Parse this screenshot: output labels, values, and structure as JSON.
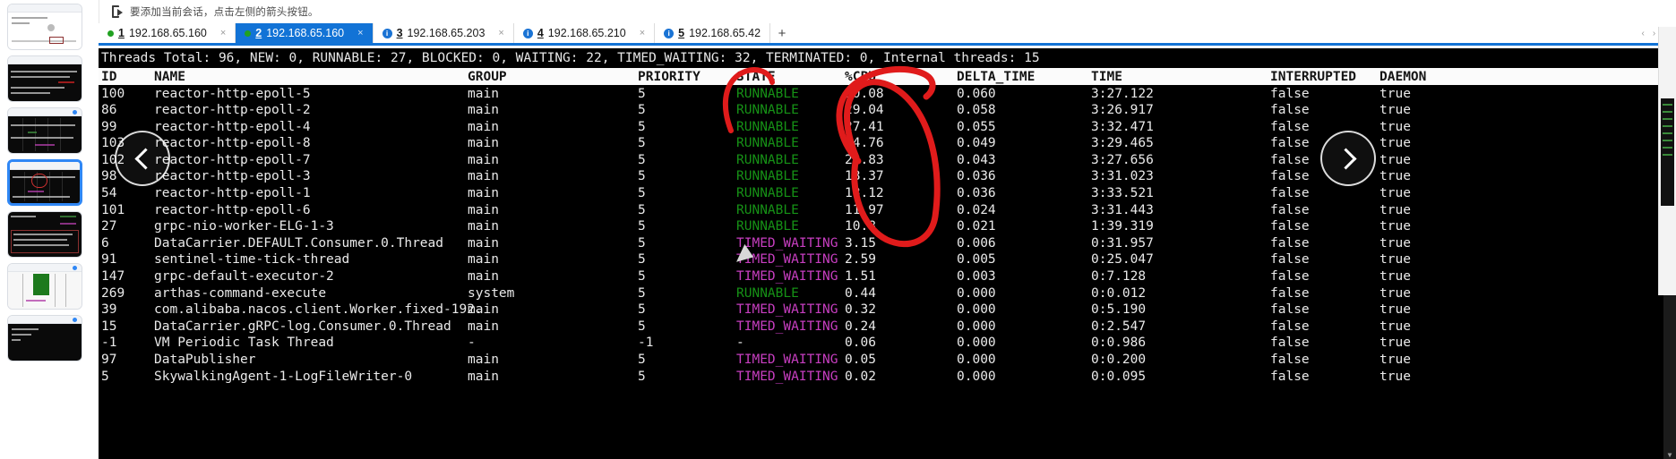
{
  "notice": {
    "icon": "export-arrow-icon",
    "text": "要添加当前会话，点击左侧的箭头按钮。"
  },
  "tabs": [
    {
      "index": "1",
      "label": "192.168.65.160",
      "status_icon": "green-dot-icon",
      "active": false,
      "close": "×"
    },
    {
      "index": "2",
      "label": "192.168.65.160",
      "status_icon": "green-dot-icon",
      "active": true,
      "close": "×"
    },
    {
      "index": "3",
      "label": "192.168.65.203",
      "status_icon": "info-icon",
      "active": false,
      "close": "×"
    },
    {
      "index": "4",
      "label": "192.168.65.210",
      "status_icon": "info-icon",
      "active": false,
      "close": "×"
    },
    {
      "index": "5",
      "label": "192.168.65.42",
      "status_icon": "info-icon",
      "active": false,
      "close": "×"
    }
  ],
  "tab_add_label": "+",
  "tab_nav": {
    "prev": "‹",
    "next": "›",
    "menu": "≡"
  },
  "terminal": {
    "summary": "Threads Total: 96, NEW: 0, RUNNABLE: 27, BLOCKED: 0, WAITING: 22, TIMED_WAITING: 32, TERMINATED: 0, Internal threads: 15",
    "columns": [
      "ID",
      "NAME",
      "GROUP",
      "PRIORITY",
      "STATE",
      "%CPU",
      "DELTA_TIME",
      "TIME",
      "INTERRUPTED",
      "DAEMON"
    ],
    "rows": [
      {
        "id": "100",
        "name": "reactor-http-epoll-5",
        "group": "main",
        "priority": "5",
        "state": "RUNNABLE",
        "cpu": "30.08",
        "delta": "0.060",
        "time": "3:27.122",
        "interrupted": "false",
        "daemon": "true"
      },
      {
        "id": "86",
        "name": "reactor-http-epoll-2",
        "group": "main",
        "priority": "5",
        "state": "RUNNABLE",
        "cpu": "29.04",
        "delta": "0.058",
        "time": "3:26.917",
        "interrupted": "false",
        "daemon": "true"
      },
      {
        "id": "99",
        "name": "reactor-http-epoll-4",
        "group": "main",
        "priority": "5",
        "state": "RUNNABLE",
        "cpu": "27.41",
        "delta": "0.055",
        "time": "3:32.471",
        "interrupted": "false",
        "daemon": "true"
      },
      {
        "id": "103",
        "name": "reactor-http-epoll-8",
        "group": "main",
        "priority": "5",
        "state": "RUNNABLE",
        "cpu": "24.76",
        "delta": "0.049",
        "time": "3:29.465",
        "interrupted": "false",
        "daemon": "true"
      },
      {
        "id": "102",
        "name": "reactor-http-epoll-7",
        "group": "main",
        "priority": "5",
        "state": "RUNNABLE",
        "cpu": "21.83",
        "delta": "0.043",
        "time": "3:27.656",
        "interrupted": "false",
        "daemon": "true"
      },
      {
        "id": "98",
        "name": "reactor-http-epoll-3",
        "group": "main",
        "priority": "5",
        "state": "RUNNABLE",
        "cpu": "18.37",
        "delta": "0.036",
        "time": "3:31.023",
        "interrupted": "false",
        "daemon": "true"
      },
      {
        "id": "54",
        "name": "reactor-http-epoll-1",
        "group": "main",
        "priority": "5",
        "state": "RUNNABLE",
        "cpu": "18.12",
        "delta": "0.036",
        "time": "3:33.521",
        "interrupted": "false",
        "daemon": "true"
      },
      {
        "id": "101",
        "name": "reactor-http-epoll-6",
        "group": "main",
        "priority": "5",
        "state": "RUNNABLE",
        "cpu": "11.97",
        "delta": "0.024",
        "time": "3:31.443",
        "interrupted": "false",
        "daemon": "true"
      },
      {
        "id": "27",
        "name": "grpc-nio-worker-ELG-1-3",
        "group": "main",
        "priority": "5",
        "state": "RUNNABLE",
        "cpu": "10.8",
        "delta": "0.021",
        "time": "1:39.319",
        "interrupted": "false",
        "daemon": "true"
      },
      {
        "id": "6",
        "name": "DataCarrier.DEFAULT.Consumer.0.Thread",
        "group": "main",
        "priority": "5",
        "state": "TIMED_WAITING",
        "cpu": "3.15",
        "delta": "0.006",
        "time": "0:31.957",
        "interrupted": "false",
        "daemon": "true"
      },
      {
        "id": "91",
        "name": "sentinel-time-tick-thread",
        "group": "main",
        "priority": "5",
        "state": "TIMED_WAITING",
        "cpu": "2.59",
        "delta": "0.005",
        "time": "0:25.047",
        "interrupted": "false",
        "daemon": "true"
      },
      {
        "id": "147",
        "name": "grpc-default-executor-2",
        "group": "main",
        "priority": "5",
        "state": "TIMED_WAITING",
        "cpu": "1.51",
        "delta": "0.003",
        "time": "0:7.128",
        "interrupted": "false",
        "daemon": "true"
      },
      {
        "id": "269",
        "name": "arthas-command-execute",
        "group": "system",
        "priority": "5",
        "state": "RUNNABLE",
        "cpu": "0.44",
        "delta": "0.000",
        "time": "0:0.012",
        "interrupted": "false",
        "daemon": "true"
      },
      {
        "id": "39",
        "name": "com.alibaba.nacos.client.Worker.fixed-192.",
        "group": "main",
        "priority": "5",
        "state": "TIMED_WAITING",
        "cpu": "0.32",
        "delta": "0.000",
        "time": "0:5.190",
        "interrupted": "false",
        "daemon": "true"
      },
      {
        "id": "15",
        "name": "DataCarrier.gRPC-log.Consumer.0.Thread",
        "group": "main",
        "priority": "5",
        "state": "TIMED_WAITING",
        "cpu": "0.24",
        "delta": "0.000",
        "time": "0:2.547",
        "interrupted": "false",
        "daemon": "true"
      },
      {
        "id": "-1",
        "name": "VM Periodic Task Thread",
        "group": "-",
        "priority": "-1",
        "state": "-",
        "cpu": "0.06",
        "delta": "0.000",
        "time": "0:0.986",
        "interrupted": "false",
        "daemon": "true"
      },
      {
        "id": "97",
        "name": "DataPublisher",
        "group": "main",
        "priority": "5",
        "state": "TIMED_WAITING",
        "cpu": "0.05",
        "delta": "0.000",
        "time": "0:0.200",
        "interrupted": "false",
        "daemon": "true"
      },
      {
        "id": "5",
        "name": "SkywalkingAgent-1-LogFileWriter-0",
        "group": "main",
        "priority": "5",
        "state": "TIMED_WAITING",
        "cpu": "0.02",
        "delta": "0.000",
        "time": "0:0.095",
        "interrupted": "false",
        "daemon": "true"
      }
    ]
  },
  "gallery": {
    "prev_label": "‹",
    "next_label": "›",
    "thumbnails": [
      {
        "name": "thumbnail-1",
        "selected": false,
        "kind": "white"
      },
      {
        "name": "thumbnail-2",
        "selected": false,
        "kind": "dark"
      },
      {
        "name": "thumbnail-3",
        "selected": false,
        "kind": "table"
      },
      {
        "name": "thumbnail-4",
        "selected": true,
        "kind": "table"
      },
      {
        "name": "thumbnail-5",
        "selected": false,
        "kind": "logs"
      },
      {
        "name": "thumbnail-6",
        "selected": false,
        "kind": "green"
      },
      {
        "name": "thumbnail-7",
        "selected": false,
        "kind": "dark"
      }
    ]
  },
  "colors": {
    "accent": "#1273d6",
    "runnable": "#169116",
    "timed_waiting": "#c73ec0",
    "annotation": "#e01b1b",
    "terminal_bg": "#000000"
  }
}
